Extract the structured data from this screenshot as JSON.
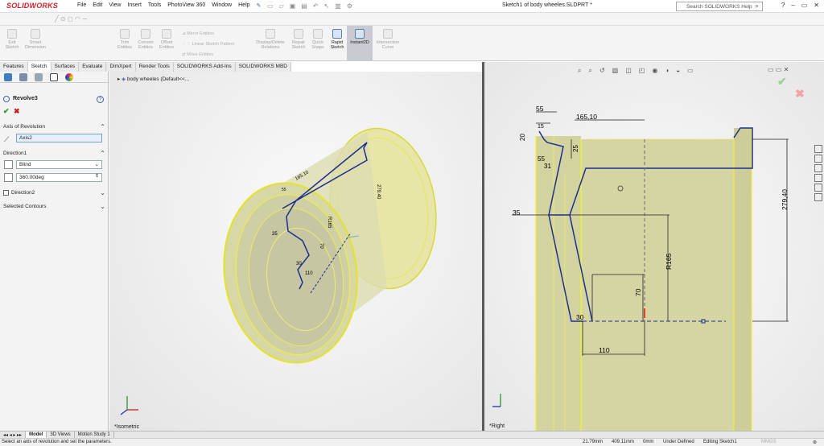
{
  "app": {
    "brand": "SOLIDWORKS",
    "doc_title": "Sketch1 of body wheeles.SLDPRT *"
  },
  "menu": [
    "File",
    "Edit",
    "View",
    "Insert",
    "Tools",
    "PhotoView 360",
    "Window",
    "Help"
  ],
  "search": {
    "placeholder": "Search SOLIDWORKS Help"
  },
  "commands": {
    "exit_sketch": "Exit Sketch",
    "smart_dimension": "Smart Dimension",
    "trim_entities": "Trim Entities",
    "convert_entities": "Convert Entities",
    "offset_entities": "Offset Entities",
    "mirror_entities": "Mirror Entities",
    "linear_sketch_pattern": "Linear Sketch Pattern",
    "move_entities": "Move Entities",
    "display_delete_relations": "Display/Delete Relations",
    "repair_sketch": "Repair Sketch",
    "quick_snaps": "Quick Snaps",
    "rapid_sketch": "Rapid Sketch",
    "instant2d": "Instant2D",
    "intersection_curve": "Intersection Curve"
  },
  "tabs": [
    "Features",
    "Sketch",
    "Surfaces",
    "Evaluate",
    "DimXpert",
    "Render Tools",
    "SOLIDWORKS Add-Ins",
    "SOLIDWORKS MBD"
  ],
  "property_manager": {
    "title": "Revolve3",
    "help": "?",
    "axis_section": "Axis of Revolution",
    "axis_value": "Axis2",
    "direction1": "Direction1",
    "end_condition": "Blind",
    "angle": "360.00deg",
    "direction2": "Direction2",
    "selected_contours": "Selected Contours"
  },
  "tree": {
    "root": "body wheeles  (Default<<..."
  },
  "views": {
    "left_label": "*Isometric",
    "right_label": "*Right"
  },
  "iso_dims": [
    "279.40",
    "165.10",
    "R165",
    "70",
    "35",
    "30",
    "110",
    "55",
    "25",
    "15",
    "20",
    "55"
  ],
  "right_dims": {
    "d55": "55",
    "d165": "165,10",
    "d15": "15",
    "d20": "20",
    "d25": "25",
    "d55b": "55",
    "d31": "31",
    "d279": "279,40",
    "d35": "35",
    "dR165": "R165",
    "d70": "70",
    "d30": "30",
    "d110": "110"
  },
  "model_tabs": [
    "Model",
    "3D Views",
    "Motion Study 1"
  ],
  "status": {
    "message": "Select an axis of revolution and set the parameters.",
    "x": "21.79mm",
    "y": "409.11mm",
    "z": "0mm",
    "state": "Under Defined",
    "mode": "Editing Sketch1",
    "units": "MMGS"
  }
}
